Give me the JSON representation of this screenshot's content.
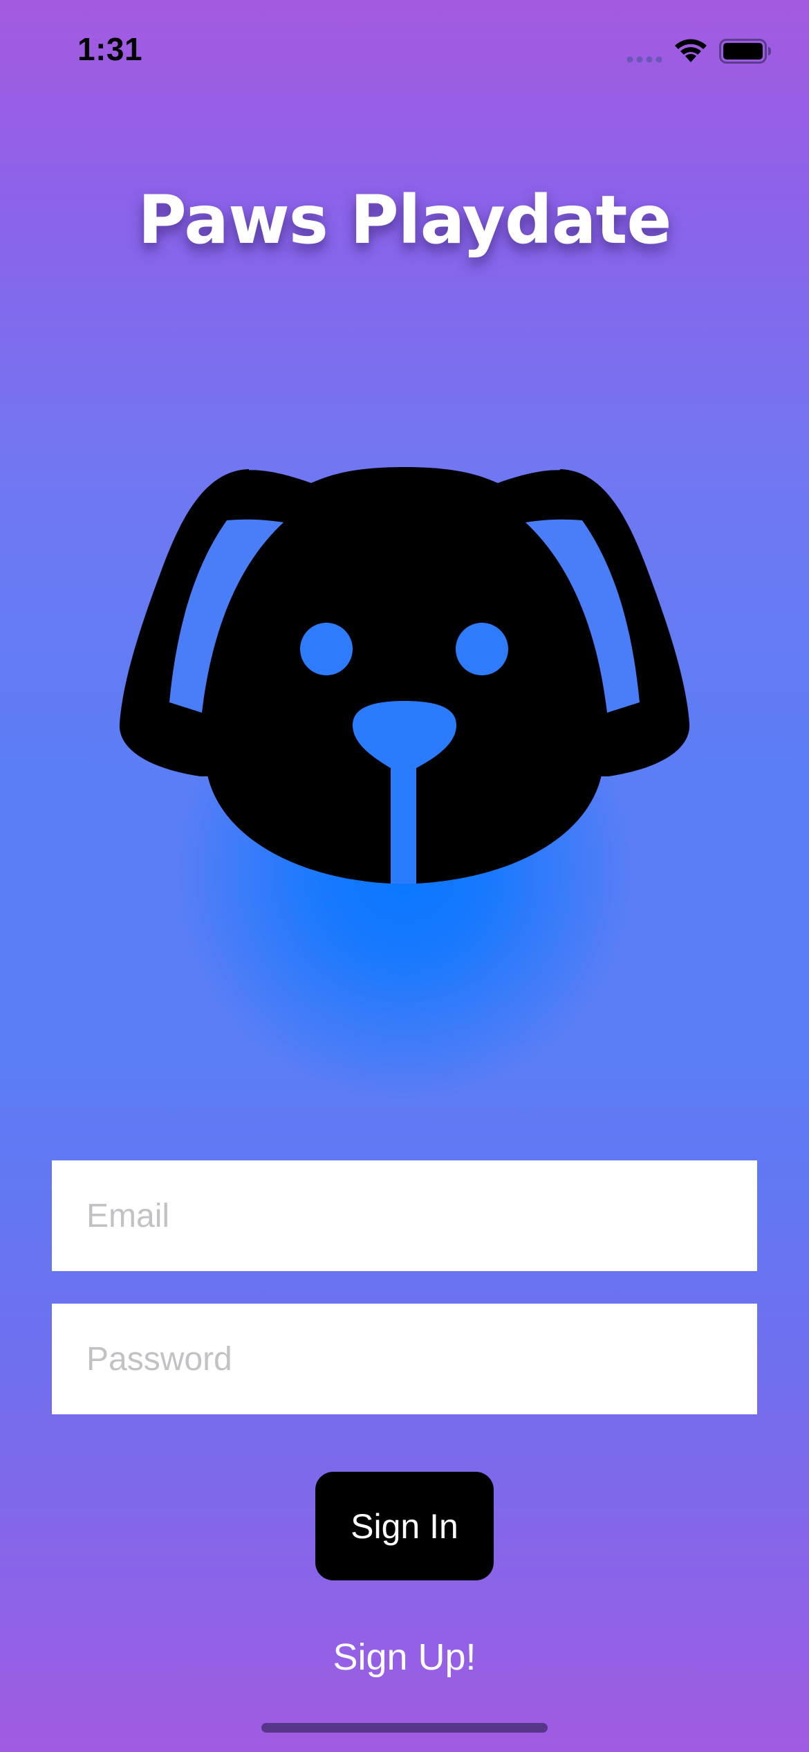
{
  "status_bar": {
    "time": "1:31",
    "icons": [
      "cellular-signal-icon",
      "wifi-icon",
      "battery-icon"
    ]
  },
  "app": {
    "title": "Paws Playdate",
    "logo_icon": "dog-face-icon"
  },
  "form": {
    "email": {
      "value": "",
      "placeholder": "Email"
    },
    "password": {
      "value": "",
      "placeholder": "Password"
    },
    "sign_in_label": "Sign In",
    "sign_up_label": "Sign Up!"
  },
  "colors": {
    "gradient_top": "#a45ae0",
    "gradient_middle": "#5a7ef6",
    "glow": "#0a78ff",
    "button_background": "#000000",
    "button_text": "#ffffff",
    "field_background": "#ffffff",
    "placeholder_text": "#c2c2c6"
  }
}
